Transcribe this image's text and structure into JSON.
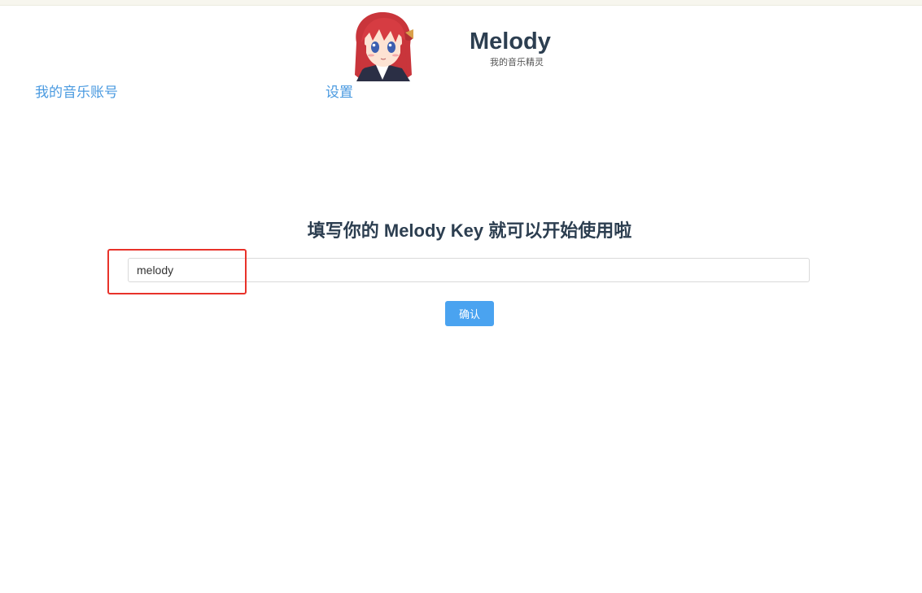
{
  "app": {
    "title": "Melody",
    "subtitle": "我的音乐精灵"
  },
  "nav": {
    "account": "我的音乐账号",
    "settings": "设置"
  },
  "main": {
    "heading": "填写你的 Melody Key 就可以开始使用啦",
    "key_input_value": "melody",
    "confirm_label": "确认"
  },
  "colors": {
    "link": "#4a9ae0",
    "button": "#4aa3f0",
    "heading": "#2c3e50",
    "highlight": "#e8322a"
  },
  "icons": {
    "avatar": "anime-girl-avatar"
  }
}
